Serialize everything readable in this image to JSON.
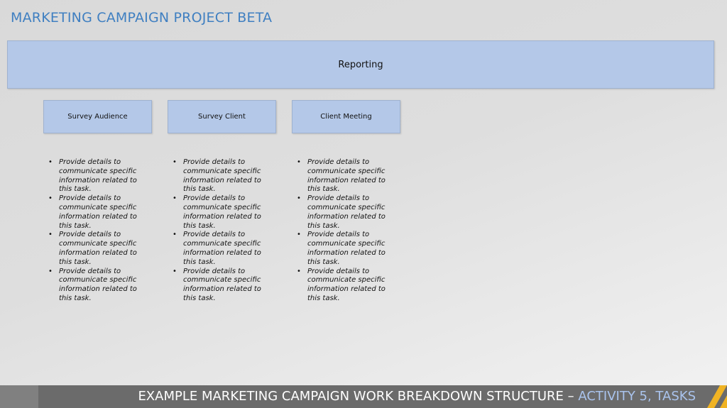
{
  "title": "MARKETING CAMPAIGN PROJECT BETA",
  "phase": {
    "label": "Reporting"
  },
  "tasks": [
    {
      "label": "Survey Audience",
      "bullets": [
        "Provide details to communicate specific information related to this task.",
        "Provide details to communicate specific information related to this task.",
        "Provide details to communicate specific information related to this task.",
        "Provide details to communicate specific information related to this task."
      ]
    },
    {
      "label": "Survey Client",
      "bullets": [
        "Provide details to communicate specific information related to this task.",
        "Provide details to communicate specific information related to this task.",
        "Provide details to communicate specific information related to this task.",
        "Provide details to communicate specific information related to this task."
      ]
    },
    {
      "label": "Client Meeting",
      "bullets": [
        "Provide details to communicate specific information related to this task.",
        "Provide details to communicate specific information related to this task.",
        "Provide details to communicate specific information related to this task.",
        "Provide details to communicate specific information related to this task."
      ]
    }
  ],
  "footer": {
    "main": "EXAMPLE MARKETING CAMPAIGN WORK BREAKDOWN STRUCTURE – ",
    "highlight": "ACTIVITY 5, TASKS"
  },
  "colors": {
    "title": "#3f7fc1",
    "box_fill": "#b4c8e8",
    "footer_bg": "#6b6b6b",
    "footer_highlight": "#aac4ee",
    "accent_stripe": "#f0b323"
  }
}
